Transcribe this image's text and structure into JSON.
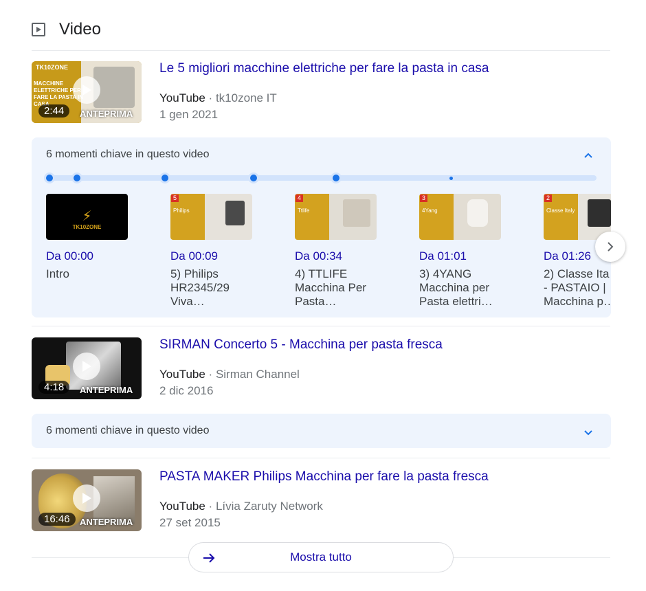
{
  "section": {
    "title": "Video",
    "show_all": "Mostra tutto"
  },
  "colors": {
    "link": "#1a0dab",
    "accent": "#1a73e8",
    "moments_bg": "#eef4fd"
  },
  "videos": [
    {
      "title": "Le 5 migliori macchine elettriche per fare la pasta in casa",
      "source": "YouTube",
      "channel": "tk10zone IT",
      "date": "1 gen 2021",
      "duration": "2:44",
      "preview_label": "ANTEPRIMA",
      "thumb_text": "MACCHINE ELETTRICHE PER FARE LA PASTA IN CASA",
      "thumb_brand": "TK10ZONE",
      "moments_label": "6 momenti chiave in questo video",
      "moments_expanded": true
    },
    {
      "title": "SIRMAN Concerto 5 - Macchina per pasta fresca",
      "source": "YouTube",
      "channel": "Sirman Channel",
      "date": "2 dic 2016",
      "duration": "4:18",
      "preview_label": "ANTEPRIMA",
      "moments_label": "6 momenti chiave in questo video",
      "moments_expanded": false
    },
    {
      "title": "PASTA MAKER Philips Macchina per fare la pasta fresca",
      "source": "YouTube",
      "channel": "Lívia Zaruty Network",
      "date": "27 set 2015",
      "duration": "16:46",
      "preview_label": "ANTEPRIMA"
    }
  ],
  "clips": [
    {
      "time": "Da 00:00",
      "label_lines": [
        "Intro"
      ],
      "thumb_text": "TK10ZONE",
      "badge": ""
    },
    {
      "time": "Da 00:09",
      "label_lines": [
        "5) Philips",
        "HR2345/29",
        "Viva…"
      ],
      "thumb_text": "Philips",
      "badge": "5"
    },
    {
      "time": "Da 00:34",
      "label_lines": [
        "4) TTLIFE",
        "Macchina Per",
        "Pasta…"
      ],
      "thumb_text": "Ttlife",
      "badge": "4"
    },
    {
      "time": "Da 01:01",
      "label_lines": [
        "3) 4YANG",
        "Macchina per",
        "Pasta elettri…"
      ],
      "thumb_text": "4Yang",
      "badge": "3"
    },
    {
      "time": "Da 01:26",
      "label_lines": [
        "2) Classe Ita",
        "- PASTAIO |",
        "Macchina p…"
      ],
      "thumb_text": "Classe Italy",
      "badge": "2"
    }
  ]
}
